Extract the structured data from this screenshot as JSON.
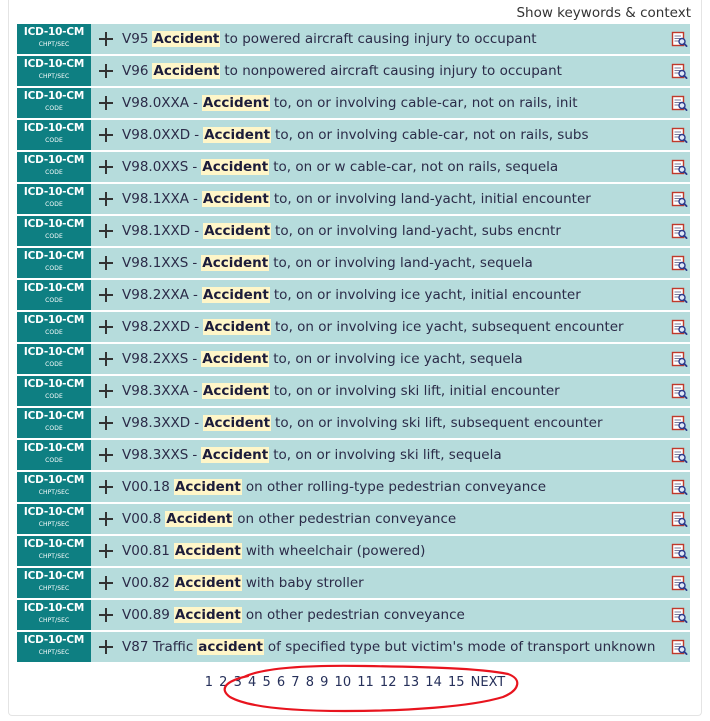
{
  "header": {
    "toggle_label": "Show keywords & context"
  },
  "badge": {
    "system": "ICD-10-CM"
  },
  "rows": [
    {
      "type": "CHPT/SEC",
      "code": "V95",
      "keyword": "Accident",
      "text": "to powered aircraft causing injury to occupant"
    },
    {
      "type": "CHPT/SEC",
      "code": "V96",
      "keyword": "Accident",
      "text": "to nonpowered aircraft causing injury to occupant"
    },
    {
      "type": "CODE",
      "code": "V98.0XXA",
      "sep": "-",
      "keyword": "Accident",
      "text": "to, on or involving cable-car, not on rails, init"
    },
    {
      "type": "CODE",
      "code": "V98.0XXD",
      "sep": "-",
      "keyword": "Accident",
      "text": "to, on or involving cable-car, not on rails, subs"
    },
    {
      "type": "CODE",
      "code": "V98.0XXS",
      "sep": "-",
      "keyword": "Accident",
      "text": "to, on or w cable-car, not on rails, sequela"
    },
    {
      "type": "CODE",
      "code": "V98.1XXA",
      "sep": "-",
      "keyword": "Accident",
      "text": "to, on or involving land-yacht, initial encounter"
    },
    {
      "type": "CODE",
      "code": "V98.1XXD",
      "sep": "-",
      "keyword": "Accident",
      "text": "to, on or involving land-yacht, subs encntr"
    },
    {
      "type": "CODE",
      "code": "V98.1XXS",
      "sep": "-",
      "keyword": "Accident",
      "text": "to, on or involving land-yacht, sequela"
    },
    {
      "type": "CODE",
      "code": "V98.2XXA",
      "sep": "-",
      "keyword": "Accident",
      "text": "to, on or involving ice yacht, initial encounter"
    },
    {
      "type": "CODE",
      "code": "V98.2XXD",
      "sep": "-",
      "keyword": "Accident",
      "text": "to, on or involving ice yacht, subsequent encounter"
    },
    {
      "type": "CODE",
      "code": "V98.2XXS",
      "sep": "-",
      "keyword": "Accident",
      "text": "to, on or involving ice yacht, sequela"
    },
    {
      "type": "CODE",
      "code": "V98.3XXA",
      "sep": "-",
      "keyword": "Accident",
      "text": "to, on or involving ski lift, initial encounter"
    },
    {
      "type": "CODE",
      "code": "V98.3XXD",
      "sep": "-",
      "keyword": "Accident",
      "text": "to, on or involving ski lift, subsequent encounter"
    },
    {
      "type": "CODE",
      "code": "V98.3XXS",
      "sep": "-",
      "keyword": "Accident",
      "text": "to, on or involving ski lift, sequela"
    },
    {
      "type": "CHPT/SEC",
      "code": "V00.18",
      "keyword": "Accident",
      "text": "on other rolling-type pedestrian conveyance"
    },
    {
      "type": "CHPT/SEC",
      "code": "V00.8",
      "keyword": "Accident",
      "text": "on other pedestrian conveyance"
    },
    {
      "type": "CHPT/SEC",
      "code": "V00.81",
      "keyword": "Accident",
      "text": "with wheelchair (powered)"
    },
    {
      "type": "CHPT/SEC",
      "code": "V00.82",
      "keyword": "Accident",
      "text": "with baby stroller"
    },
    {
      "type": "CHPT/SEC",
      "code": "V00.89",
      "keyword": "Accident",
      "text": "on other pedestrian conveyance"
    },
    {
      "type": "CHPT/SEC",
      "code": "V87 Traffic",
      "keyword": "accident",
      "text": "of specified type but victim's mode of transport unknown"
    }
  ],
  "pagination": {
    "pages": [
      "1",
      "2",
      "3",
      "4",
      "5",
      "6",
      "7",
      "8",
      "9",
      "10",
      "11",
      "12",
      "13",
      "14",
      "15"
    ],
    "next_label": "NEXT"
  },
  "colors": {
    "badge_bg": "#0e7f82",
    "row_bg": "#b6dcdc",
    "keyword_highlight": "#fff6c8",
    "annotation_ink": "#e8141e"
  },
  "icons": {
    "expand": "plus-icon",
    "details": "document-search-icon"
  }
}
